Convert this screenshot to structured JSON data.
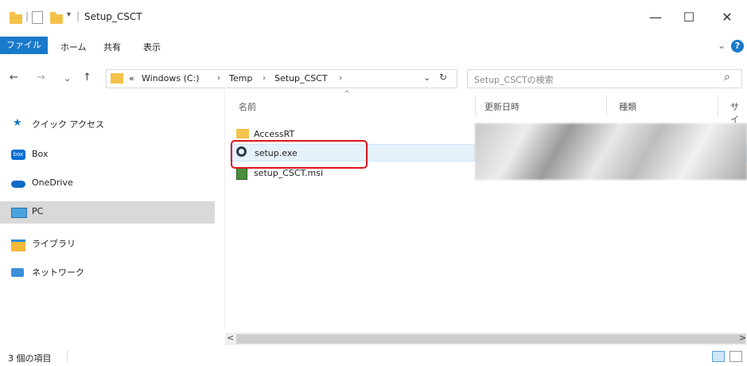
{
  "window": {
    "title": "Setup_CSCT",
    "minimize": "—",
    "maximize": "☐",
    "close": "✕"
  },
  "ribbon": {
    "tabs": [
      "ファイル",
      "ホーム",
      "共有",
      "表示"
    ],
    "expand": "⌄",
    "help": "?"
  },
  "address": {
    "back": "←",
    "forward": "→",
    "recent": "⌄",
    "up": "↑",
    "overflow": "«",
    "crumbs": [
      "Windows (C:)",
      "Temp",
      "Setup_CSCT"
    ],
    "crumb_sep": "›",
    "dropdown": "⌄",
    "refresh": "↻",
    "search_placeholder": "Setup_CSCTの検索",
    "search_icon": "⌕"
  },
  "sidebar": {
    "items": [
      {
        "label": "クイック アクセス",
        "icon": "star-icon"
      },
      {
        "label": "Box",
        "icon": "box-icon"
      },
      {
        "label": "OneDrive",
        "icon": "cloud-icon"
      },
      {
        "label": "PC",
        "icon": "pc-icon"
      },
      {
        "label": "ライブラリ",
        "icon": "library-icon"
      },
      {
        "label": "ネットワーク",
        "icon": "network-icon"
      }
    ]
  },
  "columns": [
    "名前",
    "更新日時",
    "種類",
    "サイ"
  ],
  "sort_indicator": "^",
  "files": [
    {
      "name": "AccessRT",
      "icon": "folder-icon"
    },
    {
      "name": "setup.exe",
      "icon": "installer-icon"
    },
    {
      "name": "setup_CSCT.msi",
      "icon": "msi-icon"
    }
  ],
  "scroll": {
    "left": "<",
    "right": ">"
  },
  "status": {
    "count": "3 個の項目"
  },
  "colors": {
    "accent": "#1979ca",
    "highlight_box": "#e0141e",
    "selection": "#cce8ff"
  }
}
